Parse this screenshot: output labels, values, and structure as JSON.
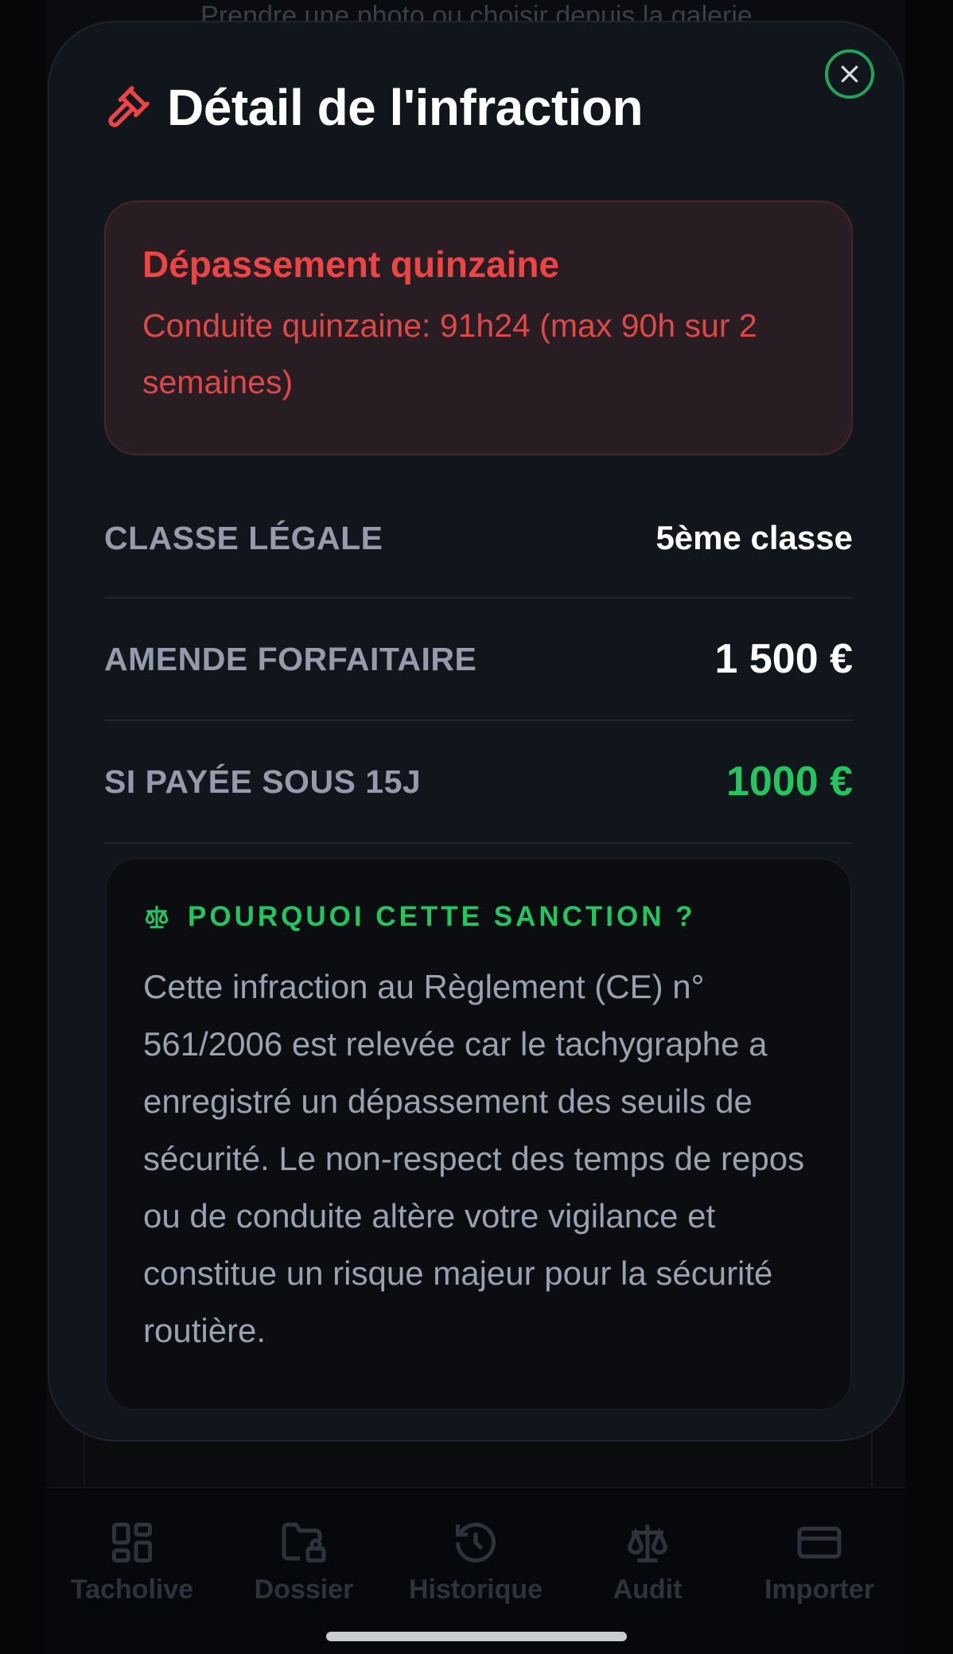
{
  "background": {
    "hint_text": "Prendre une photo ou choisir depuis la galerie",
    "tabs": [
      {
        "label": "Tacholive",
        "icon": "dashboard-grid-icon"
      },
      {
        "label": "Dossier",
        "icon": "folder-lock-icon"
      },
      {
        "label": "Historique",
        "icon": "history-clock-icon"
      },
      {
        "label": "Audit",
        "icon": "scale-balance-icon"
      },
      {
        "label": "Importer",
        "icon": "card-icon"
      }
    ]
  },
  "modal": {
    "title": "Détail de l'infraction",
    "title_icon": "gavel-icon",
    "close_icon": "close-icon",
    "alert": {
      "title": "Dépassement quinzaine",
      "text": "Conduite quinzaine: 91h24 (max 90h sur 2 semaines)"
    },
    "rows": {
      "legal_class": {
        "label": "CLASSE LÉGALE",
        "value": "5ème classe"
      },
      "fine": {
        "label": "AMENDE FORFAITAIRE",
        "value": "1 500 €"
      },
      "reduced": {
        "label": "SI PAYÉE SOUS 15J",
        "value": "1000 €"
      }
    },
    "why": {
      "icon": "scale-balance-icon",
      "title": "POURQUOI CETTE SANCTION ?",
      "text": "Cette infraction au Règlement (CE) n° 561/2006 est relevée car le tachygraphe a enregistré un dépassement des seuils de sécurité. Le non-respect des temps de repos ou de conduite altère votre vigilance et constitue un risque majeur pour la sécurité routière."
    }
  },
  "colors": {
    "accent_green": "#22c55e",
    "alert_red": "#ef4444",
    "modal_bg": "#11151c"
  }
}
